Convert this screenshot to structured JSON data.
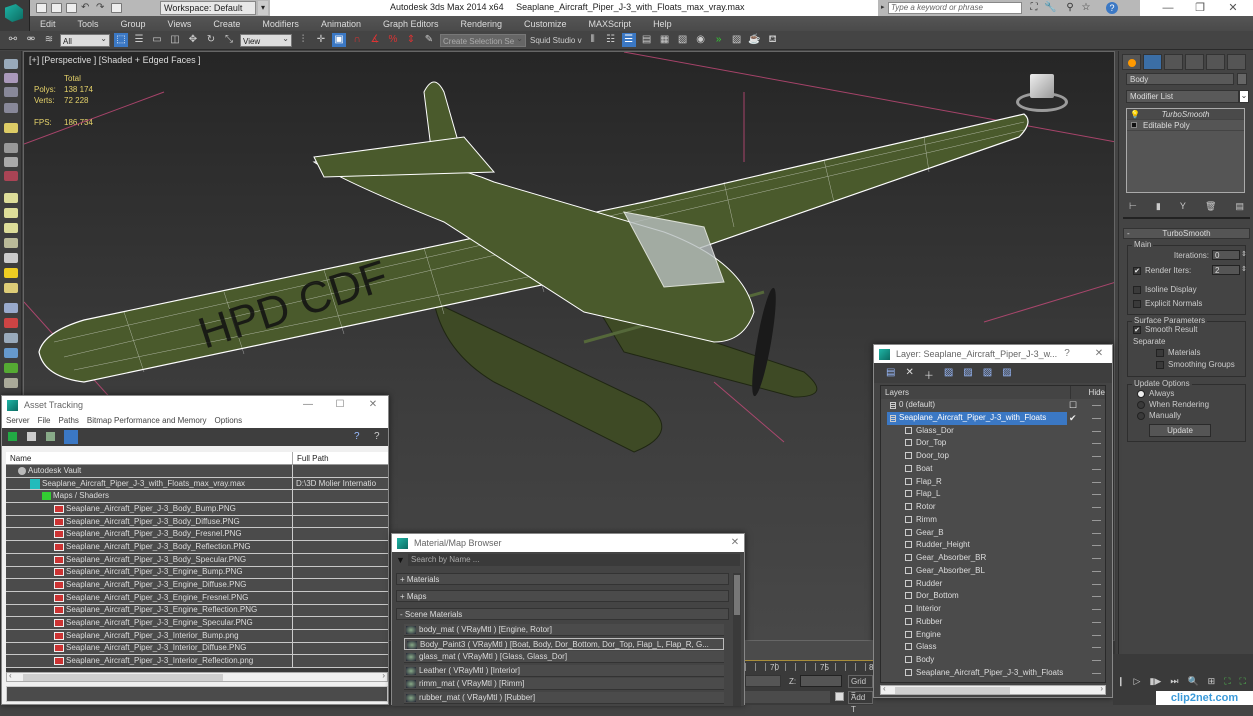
{
  "titlebar": {
    "workspace": "Workspace: Default",
    "app_title": "Autodesk 3ds Max  2014 x64",
    "file_title": "Seaplane_Aircraft_Piper_J-3_with_Floats_max_vray.max",
    "search_placeholder": "Type a keyword or phrase",
    "icons": [
      "binoculars-icon",
      "wrench-icon",
      "satellite-icon",
      "star-icon",
      "help-icon"
    ],
    "win_buttons": [
      "—",
      "❐",
      "✕"
    ]
  },
  "menu": [
    "Edit",
    "Tools",
    "Group",
    "Views",
    "Create",
    "Modifiers",
    "Animation",
    "Graph Editors",
    "Rendering",
    "Customize",
    "MAXScript",
    "Help"
  ],
  "toolbar": {
    "selection_filter": "All",
    "ref_coord": "View",
    "named_selection": "Create Selection Se",
    "label": "Squid Studio v"
  },
  "viewport": {
    "label": "[+] [Perspective ] [Shaded + Edged Faces ]",
    "stats": {
      "header": "Total",
      "polys_label": "Polys:",
      "polys": "138 174",
      "verts_label": "Verts:",
      "verts": "72 228",
      "fps_label": "FPS:",
      "fps": "186,734"
    },
    "model_colors": {
      "body": "#4a5a2c",
      "wire": "#ffffff",
      "grid": "#c64a7a"
    }
  },
  "command_panel": {
    "object_name": "Body",
    "modifier_list": "Modifier List",
    "stack": [
      "TurboSmooth",
      "Editable Poly"
    ],
    "rollout_title": "TurboSmooth",
    "main_group": "Main",
    "iterations_label": "Iterations:",
    "iterations": "0",
    "render_iters_label": "Render Iters:",
    "render_iters": "2",
    "render_iters_checked": true,
    "isoline_display": "Isoline Display",
    "explicit_normals": "Explicit Normals",
    "surface_group": "Surface Parameters",
    "smooth_result": "Smooth Result",
    "smooth_result_checked": true,
    "separate_label": "Separate",
    "materials": "Materials",
    "smoothing_groups": "Smoothing Groups",
    "update_group": "Update Options",
    "update_always": "Always",
    "update_rendering": "When Rendering",
    "update_manually": "Manually",
    "update_button": "Update"
  },
  "asset_tracking": {
    "title": "Asset Tracking",
    "menu": [
      "Server",
      "File",
      "Paths",
      "Bitmap Performance and Memory",
      "Options"
    ],
    "columns": [
      "Name",
      "Full Path"
    ],
    "rows": [
      {
        "name": "Autodesk Vault",
        "path": "",
        "level": 1,
        "icon": "vault"
      },
      {
        "name": "Seaplane_Aircraft_Piper_J-3_with_Floats_max_vray.max",
        "path": "D:\\3D Molier Internatio",
        "level": 2,
        "icon": "max"
      },
      {
        "name": "Maps / Shaders",
        "path": "",
        "level": 3,
        "icon": "maps"
      },
      {
        "name": "Seaplane_Aircraft_Piper_J-3_Body_Bump.PNG",
        "path": "",
        "level": 4,
        "icon": "png"
      },
      {
        "name": "Seaplane_Aircraft_Piper_J-3_Body_Diffuse.PNG",
        "path": "",
        "level": 4,
        "icon": "png"
      },
      {
        "name": "Seaplane_Aircraft_Piper_J-3_Body_Fresnel.PNG",
        "path": "",
        "level": 4,
        "icon": "png"
      },
      {
        "name": "Seaplane_Aircraft_Piper_J-3_Body_Reflection.PNG",
        "path": "",
        "level": 4,
        "icon": "png"
      },
      {
        "name": "Seaplane_Aircraft_Piper_J-3_Body_Specular.PNG",
        "path": "",
        "level": 4,
        "icon": "png"
      },
      {
        "name": "Seaplane_Aircraft_Piper_J-3_Engine_Bump.PNG",
        "path": "",
        "level": 4,
        "icon": "png"
      },
      {
        "name": "Seaplane_Aircraft_Piper_J-3_Engine_Diffuse.PNG",
        "path": "",
        "level": 4,
        "icon": "png"
      },
      {
        "name": "Seaplane_Aircraft_Piper_J-3_Engine_Fresnel.PNG",
        "path": "",
        "level": 4,
        "icon": "png"
      },
      {
        "name": "Seaplane_Aircraft_Piper_J-3_Engine_Reflection.PNG",
        "path": "",
        "level": 4,
        "icon": "png"
      },
      {
        "name": "Seaplane_Aircraft_Piper_J-3_Engine_Specular.PNG",
        "path": "",
        "level": 4,
        "icon": "png"
      },
      {
        "name": "Seaplane_Aircraft_Piper_J-3_Interior_Bump.png",
        "path": "",
        "level": 4,
        "icon": "png"
      },
      {
        "name": "Seaplane_Aircraft_Piper_J-3_Interior_Diffuse.PNG",
        "path": "",
        "level": 4,
        "icon": "png"
      },
      {
        "name": "Seaplane_Aircraft_Piper_J-3_Interior_Reflection.png",
        "path": "",
        "level": 4,
        "icon": "png"
      }
    ]
  },
  "material_browser": {
    "title": "Material/Map Browser",
    "search_placeholder": "Search by Name ...",
    "sections": [
      "+ Materials",
      "+ Maps",
      "- Scene Materials"
    ],
    "items": [
      "body_mat  ( VRayMtl )  [Engine, Rotor]",
      "Body_Paint3  ( VRayMtl )  [Boat, Body, Dor_Bottom, Dor_Top, Flap_L, Flap_R, G...",
      "glass_mat  ( VRayMtl )  [Glass, Glass_Dor]",
      "Leather  ( VRayMtl )  [Interior]",
      "rimm_mat  ( VRayMtl )  [Rimm]",
      "rubber_mat  ( VRayMtl )  [Rubber]"
    ],
    "selected_index": 1
  },
  "layer_dialog": {
    "title": "Layer: Seaplane_Aircraft_Piper_J-3_w...",
    "help": "?",
    "close": "✕",
    "col_layers": "Layers",
    "col_hide": "Hide",
    "layers": [
      {
        "name": "0 (default)",
        "type": "layer"
      },
      {
        "name": "Seaplane_Aircraft_Piper_J-3_with_Floats",
        "type": "layer",
        "selected": true
      }
    ],
    "objects": [
      "Glass_Dor",
      "Dor_Top",
      "Door_top",
      "Boat",
      "Flap_R",
      "Flap_L",
      "Rotor",
      "Rimm",
      "Gear_B",
      "Rudder_Height",
      "Gear_Absorber_BR",
      "Gear_Absorber_BL",
      "Rudder",
      "Dor_Bottom",
      "Interior",
      "Rubber",
      "Engine",
      "Glass",
      "Body",
      "Seaplane_Aircraft_Piper_J-3_with_Floats"
    ]
  },
  "timeline": {
    "ticks": [
      "70",
      "75",
      "8"
    ],
    "z_label": "Z:",
    "grid_label": "Grid =",
    "add_time_tag": "Add T"
  },
  "watermark": "clip2net.com"
}
